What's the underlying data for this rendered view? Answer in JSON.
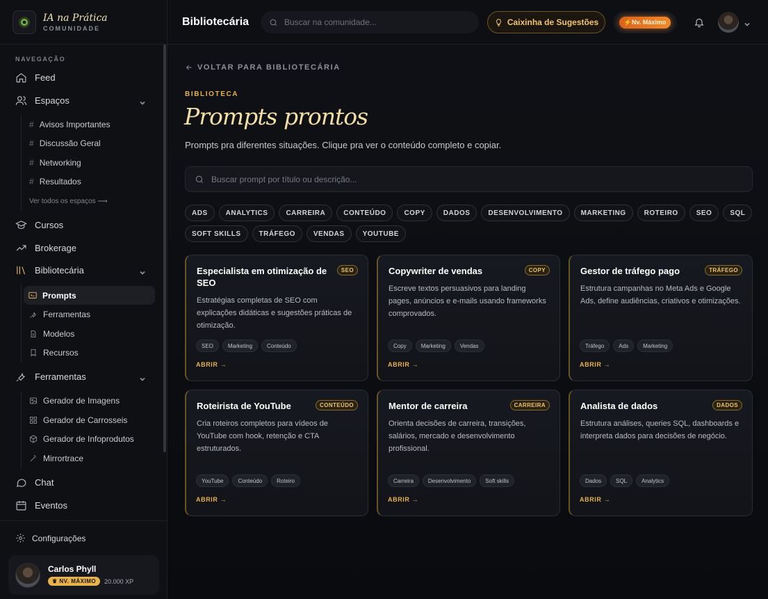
{
  "brand": {
    "title": "IA na Prática",
    "subtitle": "COMUNIDADE"
  },
  "nav": {
    "section_label": "NAVEGAÇÃO",
    "feed": "Feed",
    "espacos": "Espaços",
    "espacos_items": [
      "Avisos Importantes",
      "Discussão Geral",
      "Networking",
      "Resultados"
    ],
    "see_all": "Ver todos os espaços ⟶",
    "cursos": "Cursos",
    "brokerage": "Brokerage",
    "bibliotecaria": "Bibliotecária",
    "bibliotecaria_items": [
      "Prompts",
      "Ferramentas",
      "Modelos",
      "Recursos"
    ],
    "ferramentas": "Ferramentas",
    "ferramentas_items": [
      "Gerador de Imagens",
      "Gerador de Carrosseis",
      "Gerador de Infoprodutos",
      "Mirrortrace"
    ],
    "chat": "Chat",
    "eventos": "Eventos",
    "configuracoes": "Configurações"
  },
  "user": {
    "name": "Carlos Phyll",
    "level": "NV. MÁXIMO",
    "xp": "20.000 XP"
  },
  "topbar": {
    "title": "Bibliotecária",
    "search_placeholder": "Buscar na comunidade...",
    "suggest_label": "Caixinha de Sugestões",
    "level_label": "Nv. Máximo"
  },
  "content": {
    "back": "VOLTAR PARA BIBLIOTECÁRIA",
    "eyebrow": "BIBLIOTECA",
    "title": "Prompts prontos",
    "description": "Prompts pra diferentes situações. Clique pra ver o conteúdo completo e copiar.",
    "search_placeholder": "Buscar prompt por título ou descrição...",
    "chips_row1": [
      "ADS",
      "ANALYTICS",
      "CARREIRA",
      "CONTEÚDO",
      "COPY",
      "DADOS",
      "DESENVOLVIMENTO",
      "MARKETING",
      "ROTEIRO",
      "SEO",
      "SQL"
    ],
    "chips_row2": [
      "SOFT SKILLS",
      "TRÁFEGO",
      "VENDAS",
      "YOUTUBE"
    ],
    "open_label": "ABRIR →",
    "cards": [
      {
        "title": "Especialista em otimização de SEO",
        "tag": "SEO",
        "desc": "Estratégias completas de SEO com explicações didáticas e sugestões práticas de otimização.",
        "pills": [
          "SEO",
          "Marketing",
          "Conteúdo"
        ]
      },
      {
        "title": "Copywriter de vendas",
        "tag": "COPY",
        "desc": "Escreve textos persuasivos para landing pages, anúncios e e-mails usando frameworks comprovados.",
        "pills": [
          "Copy",
          "Marketing",
          "Vendas"
        ]
      },
      {
        "title": "Gestor de tráfego pago",
        "tag": "TRÁFEGO",
        "desc": "Estrutura campanhas no Meta Ads e Google Ads, define audiências, criativos e otimizações.",
        "pills": [
          "Tráfego",
          "Ads",
          "Marketing"
        ]
      },
      {
        "title": "Roteirista de YouTube",
        "tag": "CONTEÚDO",
        "desc": "Cria roteiros completos para vídeos de YouTube com hook, retenção e CTA estruturados.",
        "pills": [
          "YouTube",
          "Conteúdo",
          "Roteiro"
        ]
      },
      {
        "title": "Mentor de carreira",
        "tag": "CARREIRA",
        "desc": "Orienta decisões de carreira, transições, salários, mercado e desenvolvimento profissional.",
        "pills": [
          "Carreira",
          "Desenvolvimento",
          "Soft skills"
        ]
      },
      {
        "title": "Analista de dados",
        "tag": "DADOS",
        "desc": "Estrutura análises, queries SQL, dashboards e interpreta dados para decisões de negócio.",
        "pills": [
          "Dados",
          "SQL",
          "Analytics"
        ]
      }
    ]
  },
  "colors": {
    "accent": "#e7b24c",
    "background": "#0c0e12",
    "card": "#15171c",
    "level_orange": "#f08a2a"
  }
}
